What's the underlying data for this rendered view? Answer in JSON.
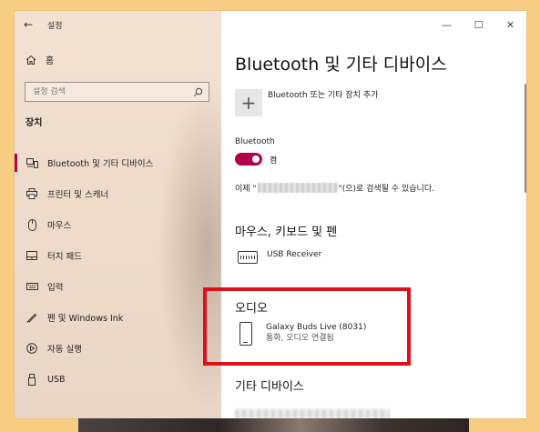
{
  "window": {
    "app_title": "설정",
    "back_icon": "back-arrow-icon",
    "controls": {
      "minimize": "—",
      "maximize": "☐",
      "close": "✕"
    }
  },
  "sidebar": {
    "home_label": "홈",
    "search": {
      "placeholder": "설정 검색",
      "icon": "search-icon"
    },
    "section_title": "장치",
    "items": [
      {
        "label": "Bluetooth 및 기타 디바이스",
        "icon": "bluetooth-devices-icon",
        "active": true
      },
      {
        "label": "프린터 및 스캐너",
        "icon": "printer-icon",
        "active": false
      },
      {
        "label": "마우스",
        "icon": "mouse-icon",
        "active": false
      },
      {
        "label": "터치 패드",
        "icon": "touchpad-icon",
        "active": false
      },
      {
        "label": "입력",
        "icon": "keyboard-icon",
        "active": false
      },
      {
        "label": "펜 및 Windows Ink",
        "icon": "pen-icon",
        "active": false
      },
      {
        "label": "자동 실행",
        "icon": "autoplay-icon",
        "active": false
      },
      {
        "label": "USB",
        "icon": "usb-icon",
        "active": false
      }
    ]
  },
  "main": {
    "page_title": "Bluetooth 및 기타 디바이스",
    "add_device_label": "Bluetooth 또는 기타 장치 추가",
    "bluetooth_label": "Bluetooth",
    "bluetooth_state": "켬",
    "discover_prefix": "이제 \"",
    "discover_suffix": "\"(으)로 검색될 수 있습니다.",
    "sections": {
      "input": {
        "title": "마우스, 키보드 및 펜",
        "device_name": "USB Receiver"
      },
      "audio": {
        "title": "오디오",
        "device_name": "Galaxy Buds Live (8031)",
        "device_status": "통화, 오디오 연결됨"
      },
      "other": {
        "title": "기타 디바이스"
      }
    }
  },
  "colors": {
    "accent": "#b3004c",
    "highlight_box": "#e0101a",
    "desktop": "#f6cd83"
  }
}
